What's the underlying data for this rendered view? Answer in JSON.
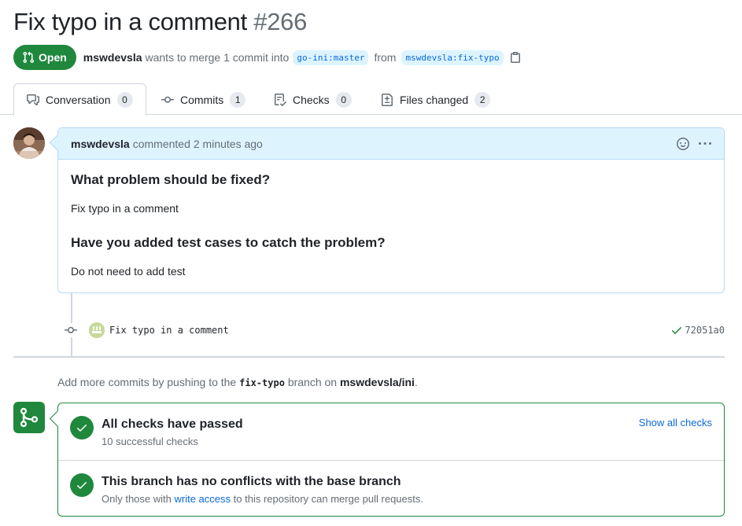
{
  "pr": {
    "title": "Fix typo in a comment",
    "number": "#266",
    "state": "Open",
    "author": "mswdevsla",
    "merge_text": "wants to merge 1 commit into",
    "base_branch": "go-ini:master",
    "from_text": "from",
    "head_branch": "mswdevsla:fix-typo"
  },
  "tabs": [
    {
      "label": "Conversation",
      "count": "0",
      "icon": "comment-discussion-icon"
    },
    {
      "label": "Commits",
      "count": "1",
      "icon": "git-commit-icon"
    },
    {
      "label": "Checks",
      "count": "0",
      "icon": "checklist-icon"
    },
    {
      "label": "Files changed",
      "count": "2",
      "icon": "file-diff-icon"
    }
  ],
  "comment": {
    "author": "mswdevsla",
    "action": "commented",
    "time": "2 minutes ago",
    "heading1": "What problem should be fixed?",
    "text1": "Fix typo in a comment",
    "heading2": "Have you added test cases to catch the problem?",
    "text2": "Do not need to add test"
  },
  "commit": {
    "message": "Fix typo in a comment",
    "sha": "72051a0",
    "status": "success"
  },
  "push_hint": {
    "prefix": "Add more commits by pushing to the",
    "branch": "fix-typo",
    "middle": "branch on",
    "repo": "mswdevsla/ini",
    "suffix": "."
  },
  "merge": {
    "checks_title": "All checks have passed",
    "checks_sub": "10 successful checks",
    "show_all": "Show all checks",
    "conflicts_title": "This branch has no conflicts with the base branch",
    "conflicts_sub_pre": "Only those with",
    "conflicts_sub_link": "write access",
    "conflicts_sub_post": "to this repository can merge pull requests."
  },
  "colors": {
    "success": "#1f883d",
    "link": "#0969da",
    "header_bg": "#ddf4ff",
    "muted": "#656d76"
  }
}
